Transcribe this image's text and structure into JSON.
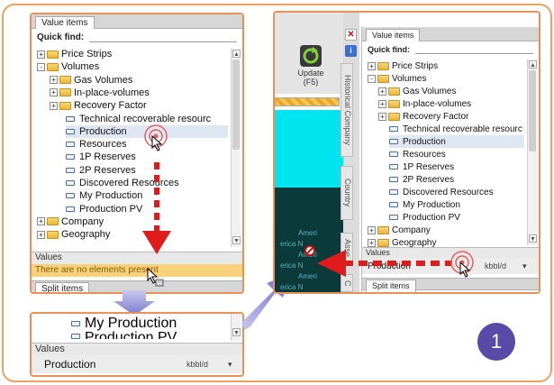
{
  "left_panel": {
    "tab": "Value items",
    "quick_find": "Quick find:",
    "tree": [
      {
        "label": "Price Strips",
        "kind": "folder",
        "expander": "+"
      },
      {
        "label": "Volumes",
        "kind": "folder",
        "expander": "-"
      },
      {
        "label": "Gas Volumes",
        "kind": "folder",
        "expander": "+"
      },
      {
        "label": "In-place-volumes",
        "kind": "folder",
        "expander": "+"
      },
      {
        "label": "Recovery Factor",
        "kind": "folder",
        "expander": "+"
      },
      {
        "label": "Technical recoverable resourc",
        "kind": "leaf"
      },
      {
        "label": "Production",
        "kind": "leaf"
      },
      {
        "label": "Resources",
        "kind": "leaf"
      },
      {
        "label": "1P Reserves",
        "kind": "leaf"
      },
      {
        "label": "2P Reserves",
        "kind": "leaf"
      },
      {
        "label": "Discovered Resources",
        "kind": "leaf"
      },
      {
        "label": "My Production",
        "kind": "leaf"
      },
      {
        "label": "Production PV",
        "kind": "leaf"
      },
      {
        "label": "Company",
        "kind": "folder",
        "expander": "+"
      },
      {
        "label": "Geography",
        "kind": "folder",
        "expander": "+"
      }
    ],
    "values_label": "Values",
    "no_elements": "There are no elements present",
    "split_items": "Split items"
  },
  "zoom_panel": {
    "items": [
      "My Production",
      "Production PV"
    ],
    "values_label": "Values",
    "value_name": "Production",
    "value_unit": "kbbl/d"
  },
  "right_panel": {
    "update_button": "Update (F5)",
    "side_tabs": [
      "Historical Company",
      "Country",
      "Asse",
      "C"
    ],
    "table_cells": [
      "Ameri",
      "erica N",
      "Ameri",
      "erica N",
      "Ameri",
      "erica N"
    ],
    "tab": "Value items",
    "quick_find": "Quick find:",
    "tree": [
      {
        "label": "Price Strips",
        "kind": "folder",
        "expander": "+"
      },
      {
        "label": "Volumes",
        "kind": "folder",
        "expander": "-"
      },
      {
        "label": "Gas Volumes",
        "kind": "folder",
        "expander": "+"
      },
      {
        "label": "In-place-volumes",
        "kind": "folder",
        "expander": "+"
      },
      {
        "label": "Recovery Factor",
        "kind": "folder",
        "expander": "+"
      },
      {
        "label": "Technical recoverable resourc",
        "kind": "leaf"
      },
      {
        "label": "Production",
        "kind": "leaf"
      },
      {
        "label": "Resources",
        "kind": "leaf"
      },
      {
        "label": "1P Reserves",
        "kind": "leaf"
      },
      {
        "label": "2P Reserves",
        "kind": "leaf"
      },
      {
        "label": "Discovered Resources",
        "kind": "leaf"
      },
      {
        "label": "My Production",
        "kind": "leaf"
      },
      {
        "label": "Production PV",
        "kind": "leaf"
      },
      {
        "label": "Company",
        "kind": "folder",
        "expander": "+"
      },
      {
        "label": "Geography",
        "kind": "folder",
        "expander": "+"
      }
    ],
    "values_label": "Values",
    "value_name": "Production",
    "value_unit": "kbbl/d",
    "split_items": "Split items"
  },
  "step_badge": "1",
  "colors": {
    "accent": "#e8915a",
    "badge": "#5a4aa8",
    "drag_arrow": "#e01b1b",
    "cyan": "#00e5f0"
  }
}
